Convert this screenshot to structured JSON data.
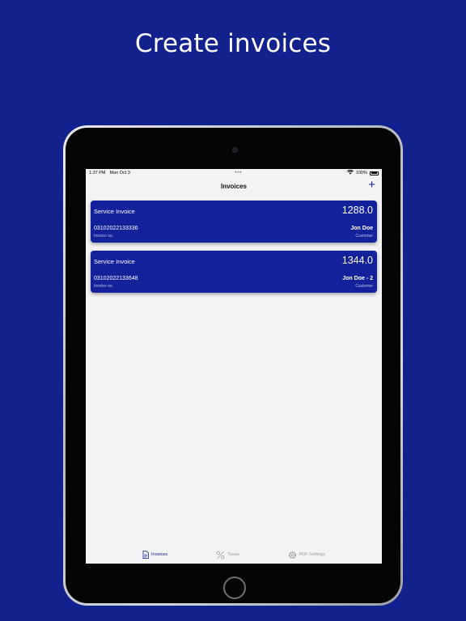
{
  "headline": "Create invoices",
  "status_bar": {
    "time": "1:37 PM",
    "date": "Mon Oct 3",
    "dots": "•••",
    "battery": "100%"
  },
  "nav": {
    "title": "Invoices",
    "add_label": "+"
  },
  "invoices": [
    {
      "title": "Service Invoice",
      "amount": "1288.0",
      "number": "03102022133336",
      "number_label": "Invoice no.",
      "customer": "Jon Doe",
      "customer_label": "Customer"
    },
    {
      "title": "Service Invoice",
      "amount": "1344.0",
      "number": "03102022133648",
      "number_label": "Invoice no.",
      "customer": "Jon Doe - 2",
      "customer_label": "Customer"
    }
  ],
  "tabs": [
    {
      "label": "Invoices",
      "icon": "document-icon",
      "active": true
    },
    {
      "label": "Taxes",
      "icon": "percent-icon",
      "active": false
    },
    {
      "label": "PDF Settings",
      "icon": "gear-icon",
      "active": false
    }
  ],
  "colors": {
    "background": "#13218c",
    "card": "#13219a",
    "accent": "#13218c"
  }
}
